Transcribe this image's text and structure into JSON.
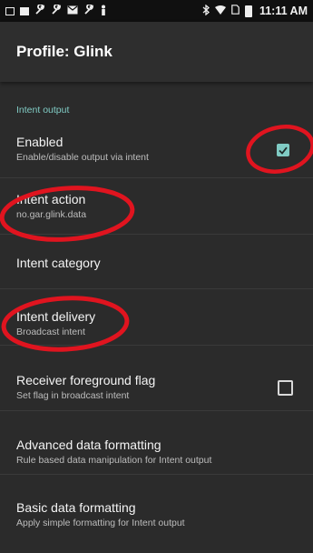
{
  "status_bar": {
    "time": "11:11 AM",
    "icons": [
      "notification-icon",
      "image-icon",
      "wrench-icon",
      "wrench-icon",
      "mail-icon",
      "wrench-icon",
      "person-icon",
      "bluetooth-icon",
      "wifi-icon",
      "sim-icon",
      "battery-icon"
    ]
  },
  "app_bar": {
    "title": "Profile: Glink"
  },
  "section": {
    "header": "Intent output"
  },
  "settings": {
    "enabled": {
      "title": "Enabled",
      "summary": "Enable/disable output via intent",
      "checked": true
    },
    "intent_action": {
      "title": "Intent action",
      "summary": "no.gar.glink.data"
    },
    "intent_category": {
      "title": "Intent category"
    },
    "intent_delivery": {
      "title": "Intent delivery",
      "summary": "Broadcast intent"
    },
    "receiver_foreground": {
      "title": "Receiver foreground flag",
      "summary": "Set flag in broadcast intent",
      "checked": false
    },
    "advanced_formatting": {
      "title": "Advanced data formatting",
      "summary": "Rule based data manipulation for Intent output"
    },
    "basic_formatting": {
      "title": "Basic data formatting",
      "summary": "Apply simple formatting for Intent output"
    }
  },
  "colors": {
    "accent": "#80cbc4",
    "annotation": "#e0141f",
    "background": "#2b2b2b"
  }
}
